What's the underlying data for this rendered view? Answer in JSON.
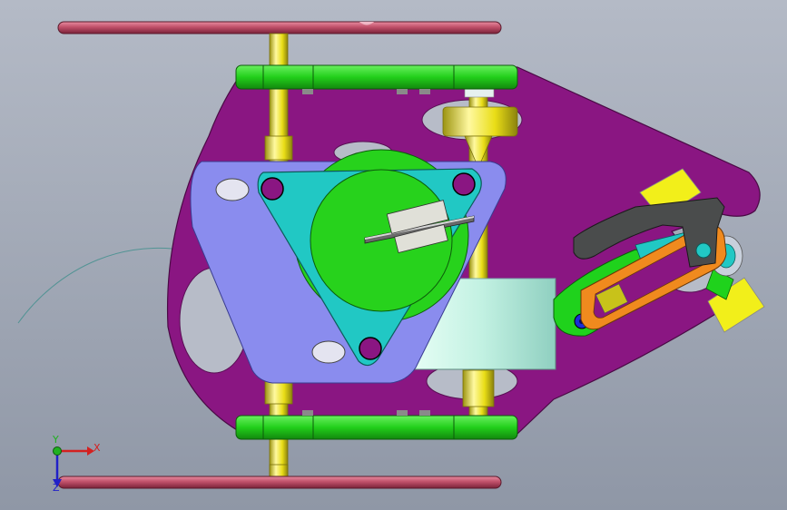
{
  "viewport": {
    "background_top": "#b4bac6",
    "background_bottom": "#8f97a6"
  },
  "colors": {
    "chassis": "#8a1682",
    "chassis_hole": "#b7bcc8",
    "rail": "#b8465e",
    "rail_highlight": "#e88ca0",
    "bracket": "#22cf1b",
    "shaft": "#e9dd16",
    "motor_plate": "#8a8cee",
    "triangle_plate": "#21c8c4",
    "motor_disc": "#27d21c",
    "gearbox": "#bff0e0",
    "arm": "#1fd21c",
    "linkage_orange": "#f08a1e",
    "linkage_dark": "#4a4c4c",
    "pad_yellow": "#f2ef1a",
    "marker_blue": "#1a2dd8",
    "axis_x": "#d42020",
    "axis_y": "#20b020",
    "axis_z": "#2020c8"
  },
  "parts": [
    "rail-top",
    "rail-bottom",
    "chassis-plate",
    "mount-bracket-top",
    "mount-bracket-bottom",
    "left-shaft",
    "right-shaft",
    "motor-plate",
    "triangle-plate",
    "motor-disc",
    "gearbox-cylinder",
    "lever-arm",
    "linkage-orange",
    "linkage-dark",
    "yellow-pad"
  ],
  "triad": {
    "x_label": "X",
    "y_label": "Y",
    "z_label": "Z"
  }
}
